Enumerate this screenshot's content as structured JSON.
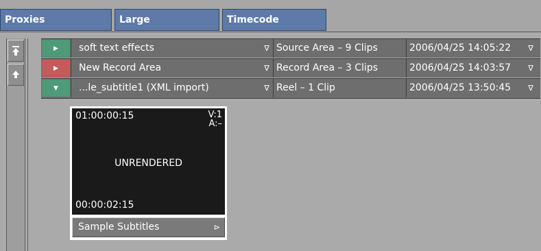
{
  "tabs": [
    {
      "label": "Proxies"
    },
    {
      "label": "Large"
    },
    {
      "label": "Timecode"
    }
  ],
  "rows": [
    {
      "expander": "collapsed-green",
      "name": "soft text effects",
      "area": "Source Area – 9 Clips",
      "date": "2006/04/25 14:05:22"
    },
    {
      "expander": "collapsed-red",
      "name": "New Record Area",
      "area": "Record Area – 3 Clips",
      "date": "2006/04/25 14:03:57"
    },
    {
      "expander": "expanded-green",
      "name": "...le_subtitle1 (XML import)",
      "area": "Reel – 1 Clip",
      "date": "2006/04/25 13:50:45"
    }
  ],
  "clip": {
    "timecode_in": "01:00:00:15",
    "video_track": "V:1",
    "audio_track": "A:–",
    "status": "UNRENDERED",
    "duration": "00:00:02:15",
    "label": "Sample Subtitles"
  },
  "colors": {
    "tab_bg": "#5d7aa8",
    "expander_green": "#4f9a78",
    "expander_red": "#c65a5a",
    "row_bg": "#6e6e6e",
    "panel_bg": "#aaaaaa"
  },
  "icons": {
    "dropdown": "∇",
    "collapsed": "▶",
    "expanded": "▼",
    "label_arrow": "⊳",
    "scroll_top": "⤒",
    "scroll_up": "▲"
  }
}
